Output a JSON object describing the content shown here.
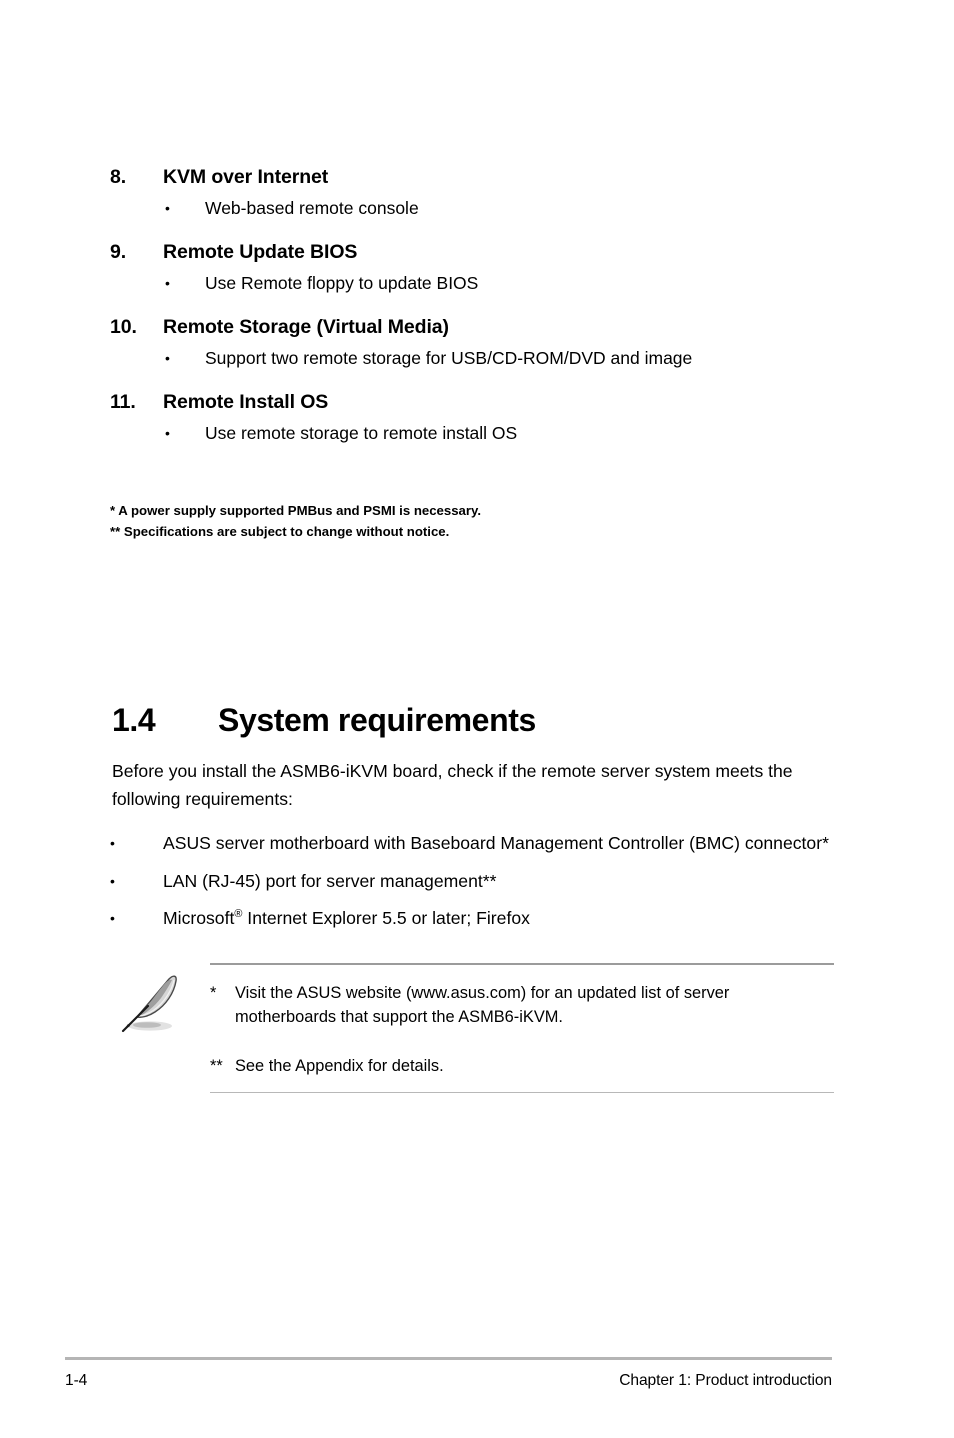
{
  "features": [
    {
      "number": "8.",
      "title": "KVM over Internet",
      "bullet": "Web-based remote console"
    },
    {
      "number": "9.",
      "title": "Remote Update BIOS",
      "bullet": "Use Remote floppy to update BIOS"
    },
    {
      "number": "10.",
      "title": "Remote Storage (Virtual Media)",
      "bullet": "Support two remote storage for USB/CD-ROM/DVD and image"
    },
    {
      "number": "11.",
      "title": "Remote Install OS",
      "bullet": "Use remote storage to remote install OS"
    }
  ],
  "bullet_glyph": "•",
  "footnotes": [
    "* A power supply supported PMBus and PSMI is necessary.",
    "** Specifications are subject to change without notice."
  ],
  "section": {
    "number": "1.4",
    "title": "System requirements",
    "intro": "Before you install the ASMB6-iKVM board, check if the remote server system meets the following requirements:"
  },
  "requirements": [
    {
      "text_before": "ASUS server motherboard with Baseboard Management Controller (BMC) connector*",
      "has_superscript": false,
      "text_after": ""
    },
    {
      "text_before": "LAN (RJ-45) port for server management**",
      "has_superscript": false,
      "text_after": ""
    },
    {
      "text_before": "Microsoft",
      "has_superscript": true,
      "superscript": "®",
      "text_after": " Internet Explorer 5.5 or later; Firefox"
    }
  ],
  "note": {
    "icon": "quill-pen-icon",
    "items": [
      {
        "marker": "*",
        "text": "Visit the ASUS website (www.asus.com) for an updated list of server motherboards that support the ASMB6-iKVM."
      },
      {
        "marker": "**",
        "text": "See the Appendix for details."
      }
    ]
  },
  "footer": {
    "page_number": "1-4",
    "chapter": "Chapter 1: Product introduction"
  },
  "colors": {
    "text": "#000000",
    "rule_top": "#9b9b9b",
    "rule_bottom": "#b8b8b8",
    "footer_rule": "#b5b5b5",
    "page_background": "#ffffff"
  }
}
